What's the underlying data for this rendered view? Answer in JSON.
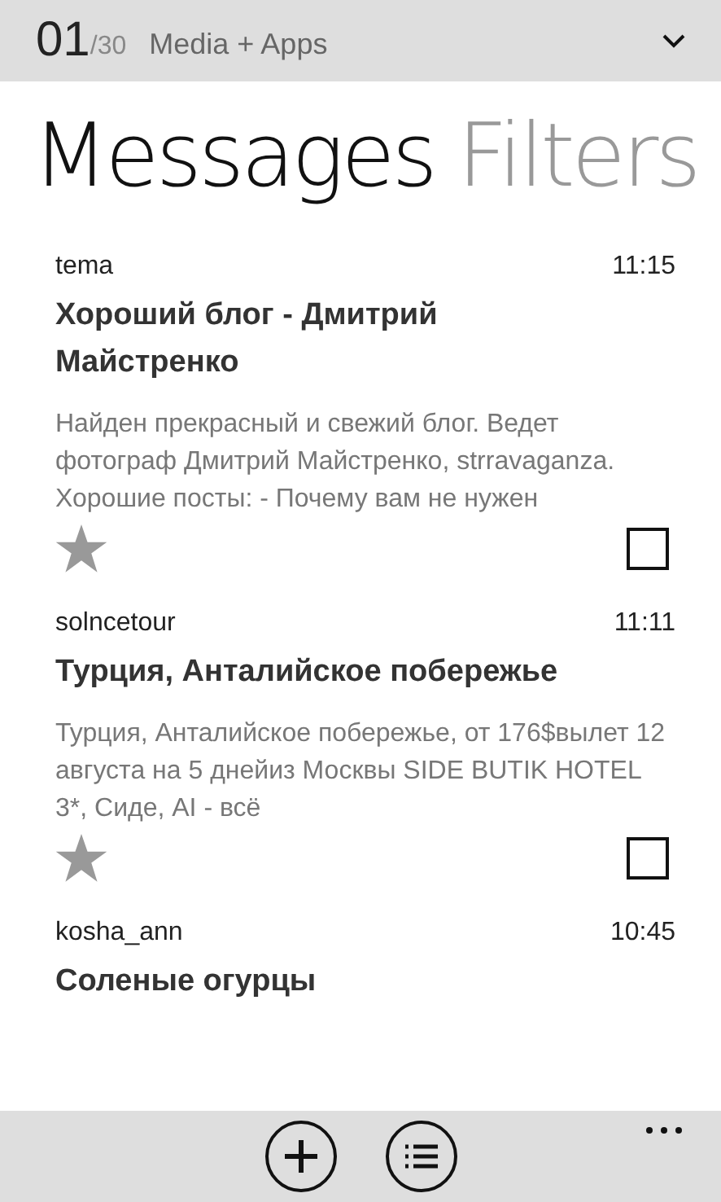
{
  "header": {
    "index": "01",
    "total": "/30",
    "category": "Media + Apps"
  },
  "pivots": [
    {
      "label": "Messages",
      "selected": true
    },
    {
      "label": "Filters",
      "selected": false
    }
  ],
  "messages": [
    {
      "sender": "tema",
      "time": "11:15",
      "title": "Хороший блог - Дмитрий Майстренко",
      "preview": "Найден прекрасный и свежий блог. Ведет фотограф Дмитрий Майстренко, strravaganza. Хорошие посты: - Почему вам не нужен",
      "starred": false,
      "checked": false
    },
    {
      "sender": "solncetour",
      "time": "11:11",
      "title": "Турция, Анталийское побережье",
      "preview": "Турция, Анталийское побережье, от 176$вылет 12 августа на 5 днейиз Москвы SIDE BUTIK HOTEL 3*, Сиде, AI - всё",
      "starred": false,
      "checked": false
    },
    {
      "sender": "kosha_ann",
      "time": "10:45",
      "title": "Соленые огурцы"
    }
  ]
}
